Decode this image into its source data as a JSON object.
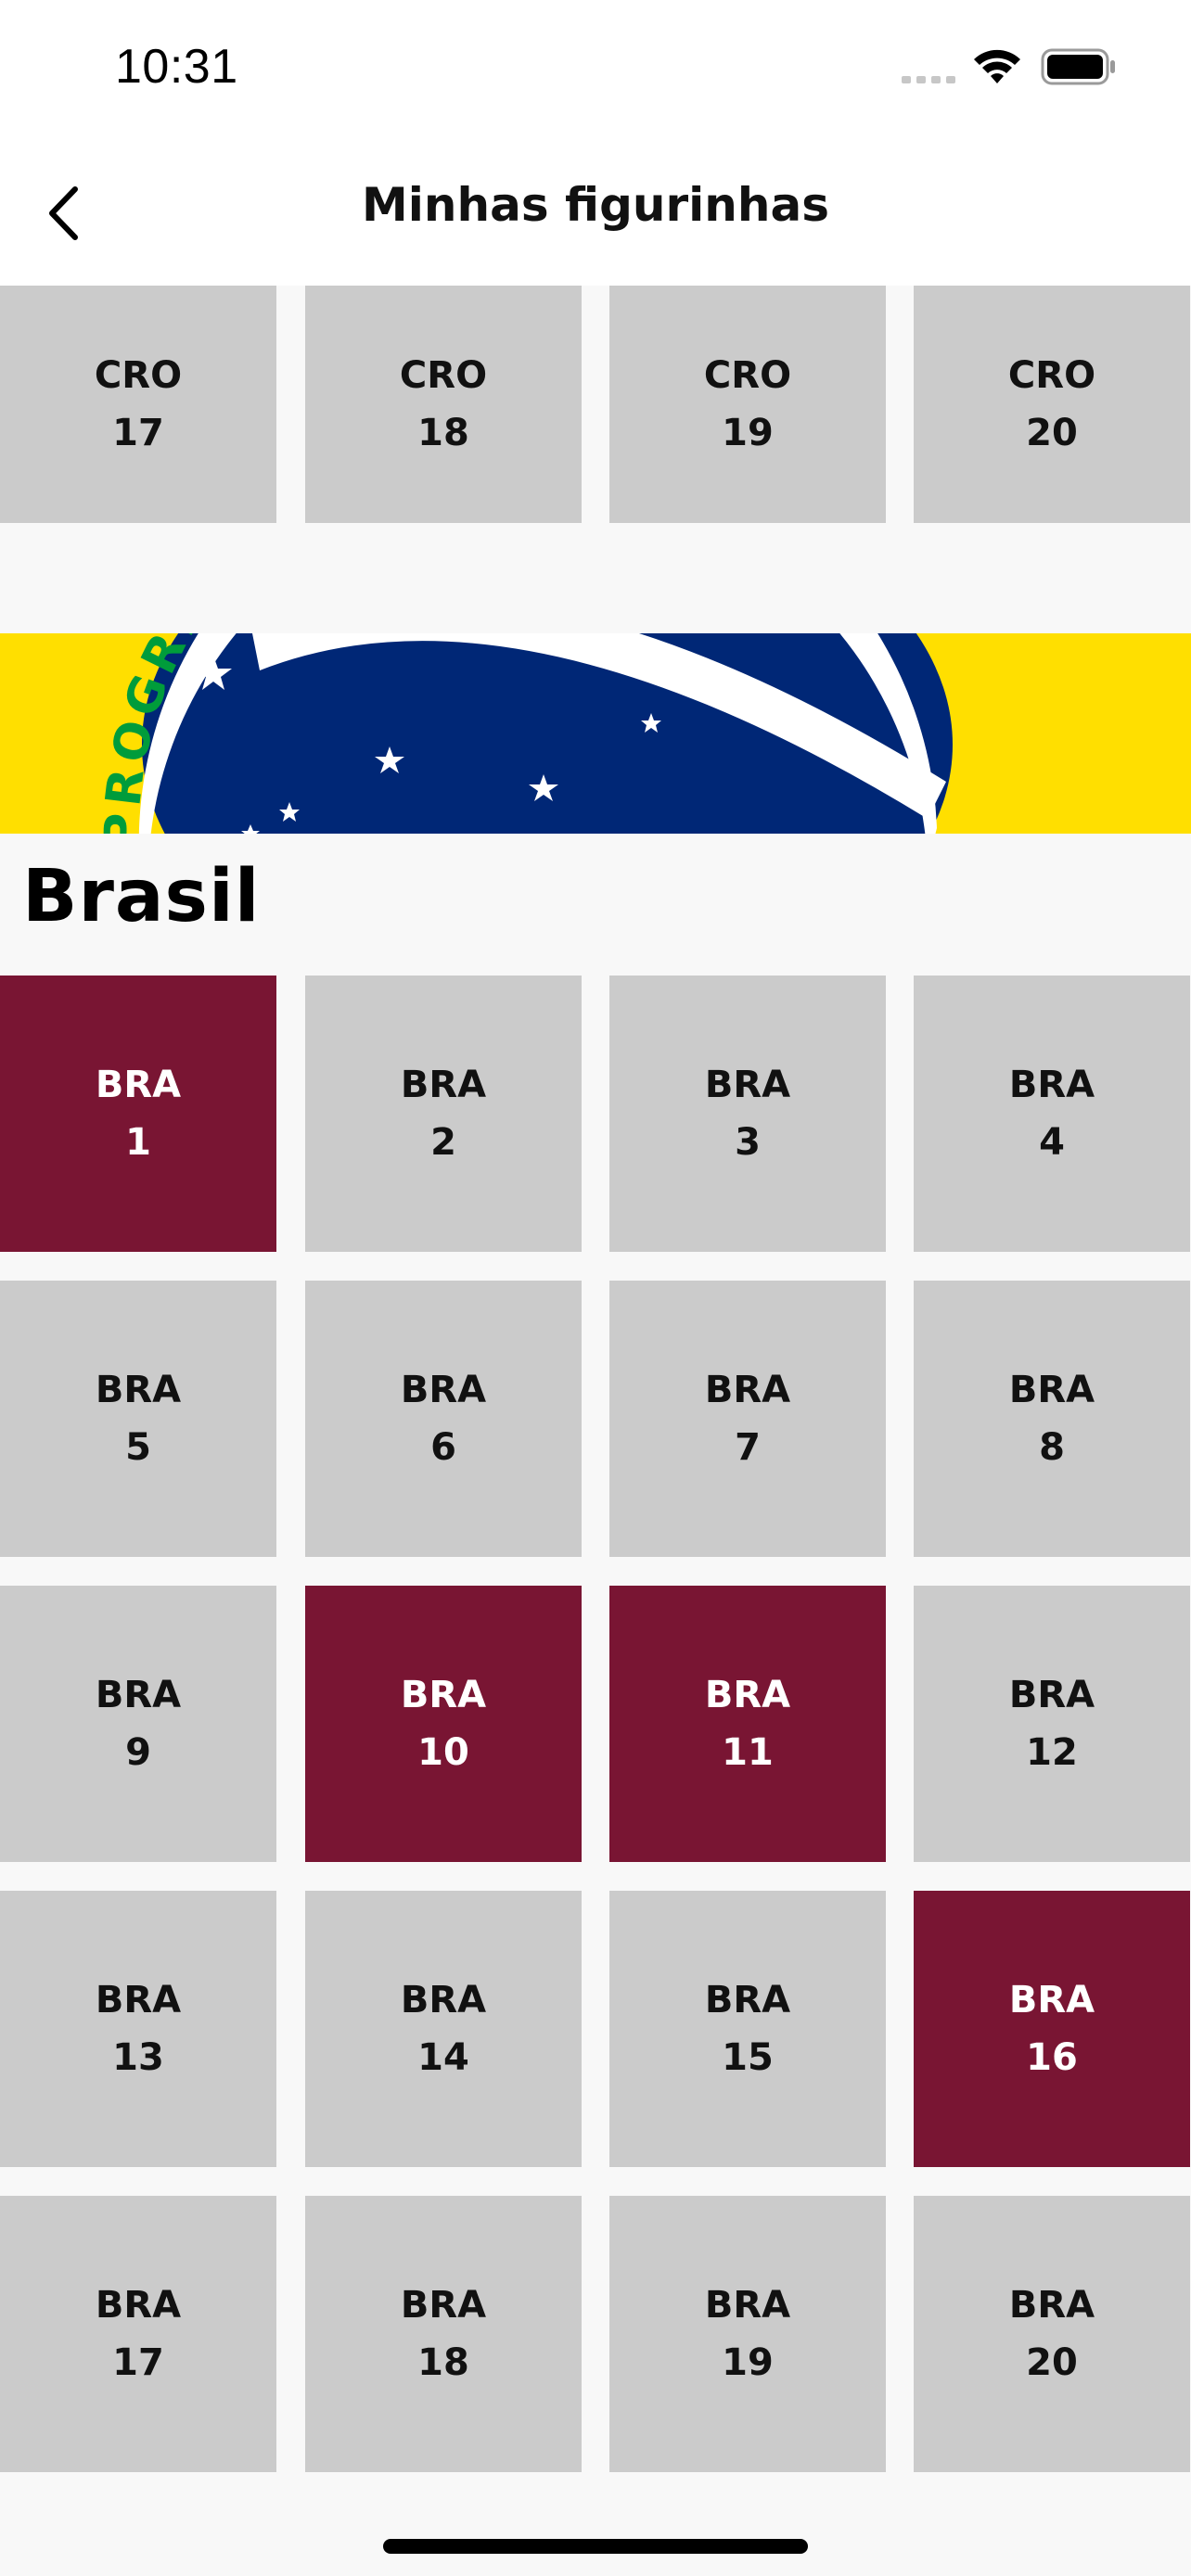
{
  "status_bar": {
    "time": "10:31"
  },
  "header": {
    "title": "Minhas figurinhas",
    "back_icon": "chevron-left-icon"
  },
  "colors": {
    "owned": "#791533",
    "missing": "#cbcbcb",
    "flag_yellow": "#ffdf00",
    "flag_blue": "#002776"
  },
  "previous_section": {
    "stickers": [
      {
        "code": "CRO",
        "number": "17",
        "owned": false
      },
      {
        "code": "CRO",
        "number": "18",
        "owned": false
      },
      {
        "code": "CRO",
        "number": "19",
        "owned": false
      },
      {
        "code": "CRO",
        "number": "20",
        "owned": false
      }
    ]
  },
  "section": {
    "name": "Brasil",
    "flag_motto": "PROGRESSO",
    "stickers": [
      {
        "code": "BRA",
        "number": "1",
        "owned": true
      },
      {
        "code": "BRA",
        "number": "2",
        "owned": false
      },
      {
        "code": "BRA",
        "number": "3",
        "owned": false
      },
      {
        "code": "BRA",
        "number": "4",
        "owned": false
      },
      {
        "code": "BRA",
        "number": "5",
        "owned": false
      },
      {
        "code": "BRA",
        "number": "6",
        "owned": false
      },
      {
        "code": "BRA",
        "number": "7",
        "owned": false
      },
      {
        "code": "BRA",
        "number": "8",
        "owned": false
      },
      {
        "code": "BRA",
        "number": "9",
        "owned": false
      },
      {
        "code": "BRA",
        "number": "10",
        "owned": true
      },
      {
        "code": "BRA",
        "number": "11",
        "owned": true
      },
      {
        "code": "BRA",
        "number": "12",
        "owned": false
      },
      {
        "code": "BRA",
        "number": "13",
        "owned": false
      },
      {
        "code": "BRA",
        "number": "14",
        "owned": false
      },
      {
        "code": "BRA",
        "number": "15",
        "owned": false
      },
      {
        "code": "BRA",
        "number": "16",
        "owned": true
      },
      {
        "code": "BRA",
        "number": "17",
        "owned": false
      },
      {
        "code": "BRA",
        "number": "18",
        "owned": false
      },
      {
        "code": "BRA",
        "number": "19",
        "owned": false
      },
      {
        "code": "BRA",
        "number": "20",
        "owned": false
      }
    ]
  }
}
